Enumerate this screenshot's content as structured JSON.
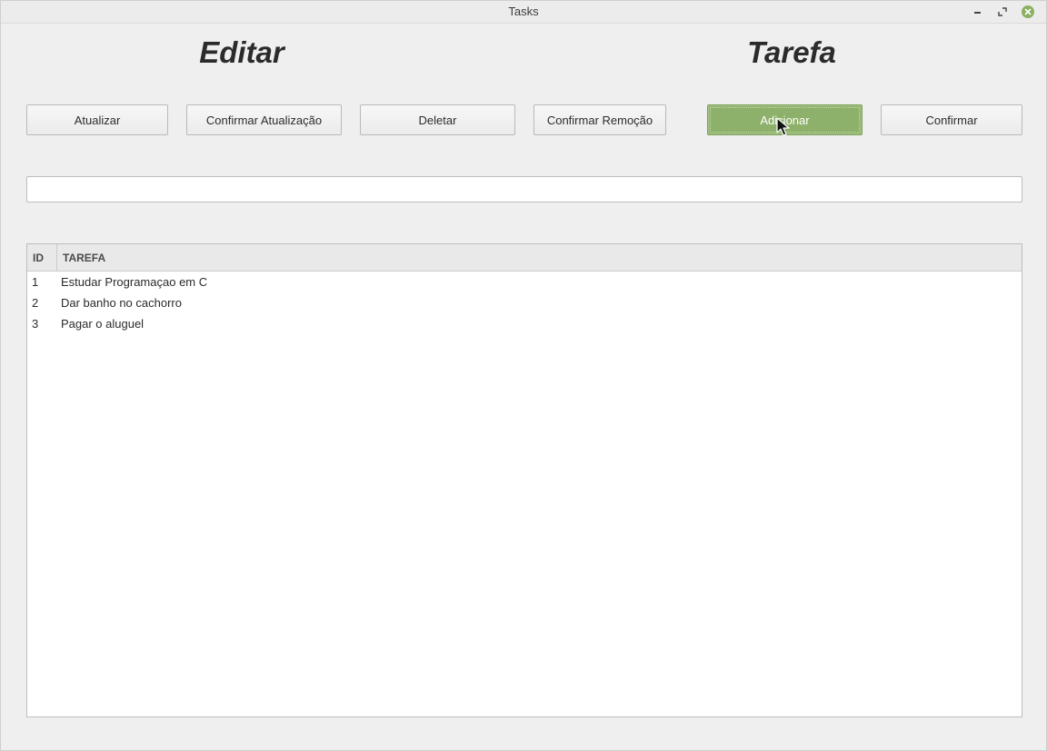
{
  "window": {
    "title": "Tasks"
  },
  "headings": {
    "left": "Editar",
    "right": "Tarefa"
  },
  "toolbar": {
    "buttons": [
      {
        "label": "Atualizar"
      },
      {
        "label": "Confirmar Atualização"
      },
      {
        "label": "Deletar"
      },
      {
        "label": "Confirmar Remoção"
      },
      {
        "label": "Adicionar"
      },
      {
        "label": "Confirmar"
      }
    ]
  },
  "task_input": {
    "value": "",
    "placeholder": ""
  },
  "table": {
    "columns": [
      "ID",
      "TAREFA"
    ],
    "rows": [
      {
        "id": "1",
        "task": "Estudar Programaçao em C"
      },
      {
        "id": "2",
        "task": "Dar banho no cachorro"
      },
      {
        "id": "3",
        "task": "Pagar o aluguel"
      }
    ]
  },
  "colors": {
    "accent_green": "#8db06a",
    "close_button": "#8bb062"
  },
  "icons": {
    "minimize": "minimize-icon",
    "maximize": "maximize-icon",
    "close": "close-icon",
    "cursor": "mouse-pointer-icon"
  }
}
